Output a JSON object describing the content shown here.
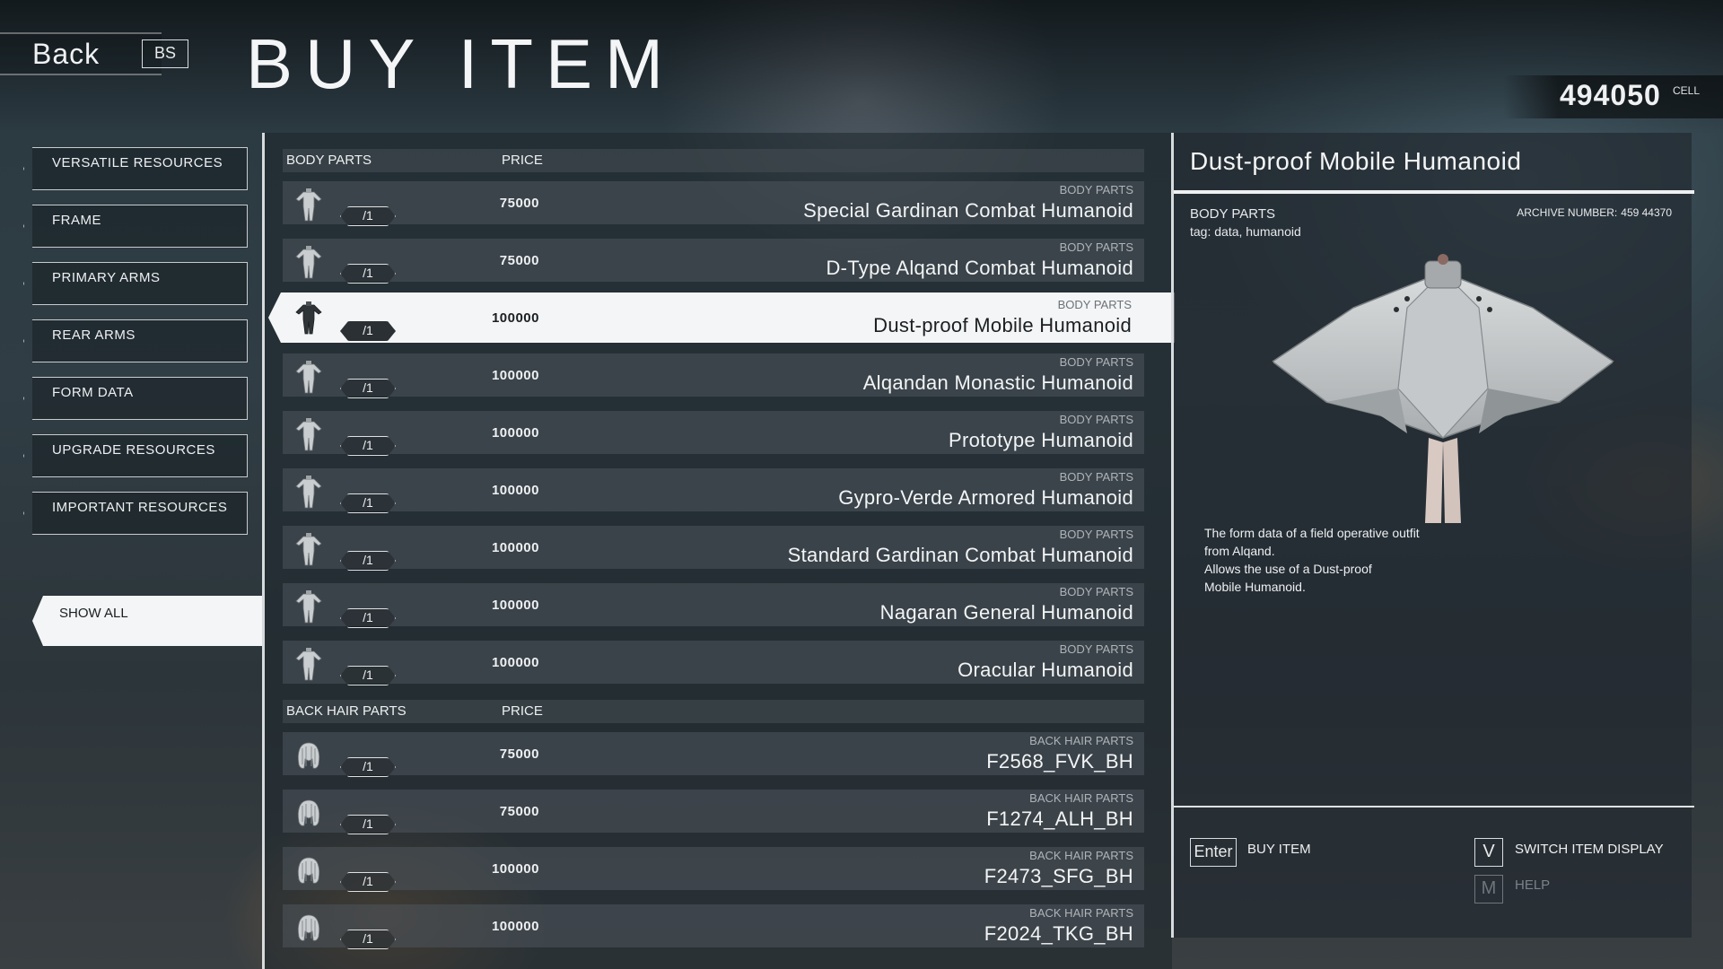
{
  "header": {
    "back_label": "Back",
    "back_key": "BS",
    "title": "BUY ITEM",
    "currency_value": "494050",
    "currency_unit": "CELL"
  },
  "categories": [
    {
      "label": "VERSATILE RESOURCES"
    },
    {
      "label": "FRAME"
    },
    {
      "label": "PRIMARY ARMS"
    },
    {
      "label": "REAR ARMS"
    },
    {
      "label": "FORM DATA"
    },
    {
      "label": "UPGRADE RESOURCES"
    },
    {
      "label": "IMPORTANT RESOURCES"
    }
  ],
  "show_all_label": "SHOW ALL",
  "list": {
    "price_header": "PRICE",
    "sections": [
      {
        "name": "BODY PARTS",
        "items": [
          {
            "category": "BODY PARTS",
            "name": "Special Gardinan Combat Humanoid",
            "price": "75000",
            "qty": "/1",
            "icon": "body-parts-icon"
          },
          {
            "category": "BODY PARTS",
            "name": "D-Type Alqand Combat Humanoid",
            "price": "75000",
            "qty": "/1",
            "icon": "body-parts-icon"
          },
          {
            "category": "BODY PARTS",
            "name": "Dust-proof Mobile Humanoid",
            "price": "100000",
            "qty": "/1",
            "icon": "body-parts-icon",
            "selected": true
          },
          {
            "category": "BODY PARTS",
            "name": "Alqandan Monastic Humanoid",
            "price": "100000",
            "qty": "/1",
            "icon": "body-parts-icon"
          },
          {
            "category": "BODY PARTS",
            "name": "Prototype Humanoid",
            "price": "100000",
            "qty": "/1",
            "icon": "body-parts-icon"
          },
          {
            "category": "BODY PARTS",
            "name": "Gypro-Verde Armored Humanoid",
            "price": "100000",
            "qty": "/1",
            "icon": "body-parts-icon"
          },
          {
            "category": "BODY PARTS",
            "name": "Standard Gardinan Combat Humanoid",
            "price": "100000",
            "qty": "/1",
            "icon": "body-parts-icon"
          },
          {
            "category": "BODY PARTS",
            "name": "Nagaran General Humanoid",
            "price": "100000",
            "qty": "/1",
            "icon": "body-parts-icon"
          },
          {
            "category": "BODY PARTS",
            "name": "Oracular Humanoid",
            "price": "100000",
            "qty": "/1",
            "icon": "body-parts-icon"
          }
        ]
      },
      {
        "name": "BACK HAIR PARTS",
        "items": [
          {
            "category": "BACK HAIR PARTS",
            "name": "F2568_FVK_BH",
            "price": "75000",
            "qty": "/1",
            "icon": "back-hair-icon"
          },
          {
            "category": "BACK HAIR PARTS",
            "name": "F1274_ALH_BH",
            "price": "75000",
            "qty": "/1",
            "icon": "back-hair-icon"
          },
          {
            "category": "BACK HAIR PARTS",
            "name": "F2473_SFG_BH",
            "price": "100000",
            "qty": "/1",
            "icon": "back-hair-icon"
          },
          {
            "category": "BACK HAIR PARTS",
            "name": "F2024_TKG_BH",
            "price": "100000",
            "qty": "/1",
            "icon": "back-hair-icon"
          }
        ]
      }
    ]
  },
  "detail": {
    "title": "Dust-proof Mobile Humanoid",
    "category": "BODY PARTS",
    "tag": "tag: data, humanoid",
    "archive_label": "ARCHIVE NUMBER:",
    "archive_number": "459 44370",
    "description_lines": [
      "The form data of a field operative outfit",
      "from Alqand.",
      "Allows the use of a Dust-proof",
      "Mobile Humanoid."
    ]
  },
  "actions": {
    "buy_key": "Enter",
    "buy_label": "BUY ITEM",
    "switch_key": "V",
    "switch_label": "SWITCH ITEM DISPLAY",
    "help_key": "M",
    "help_label": "HELP"
  },
  "colors": {
    "selected_row": "#f4f5f6",
    "row_bg": "#4e565c",
    "text": "#eef0f2"
  }
}
